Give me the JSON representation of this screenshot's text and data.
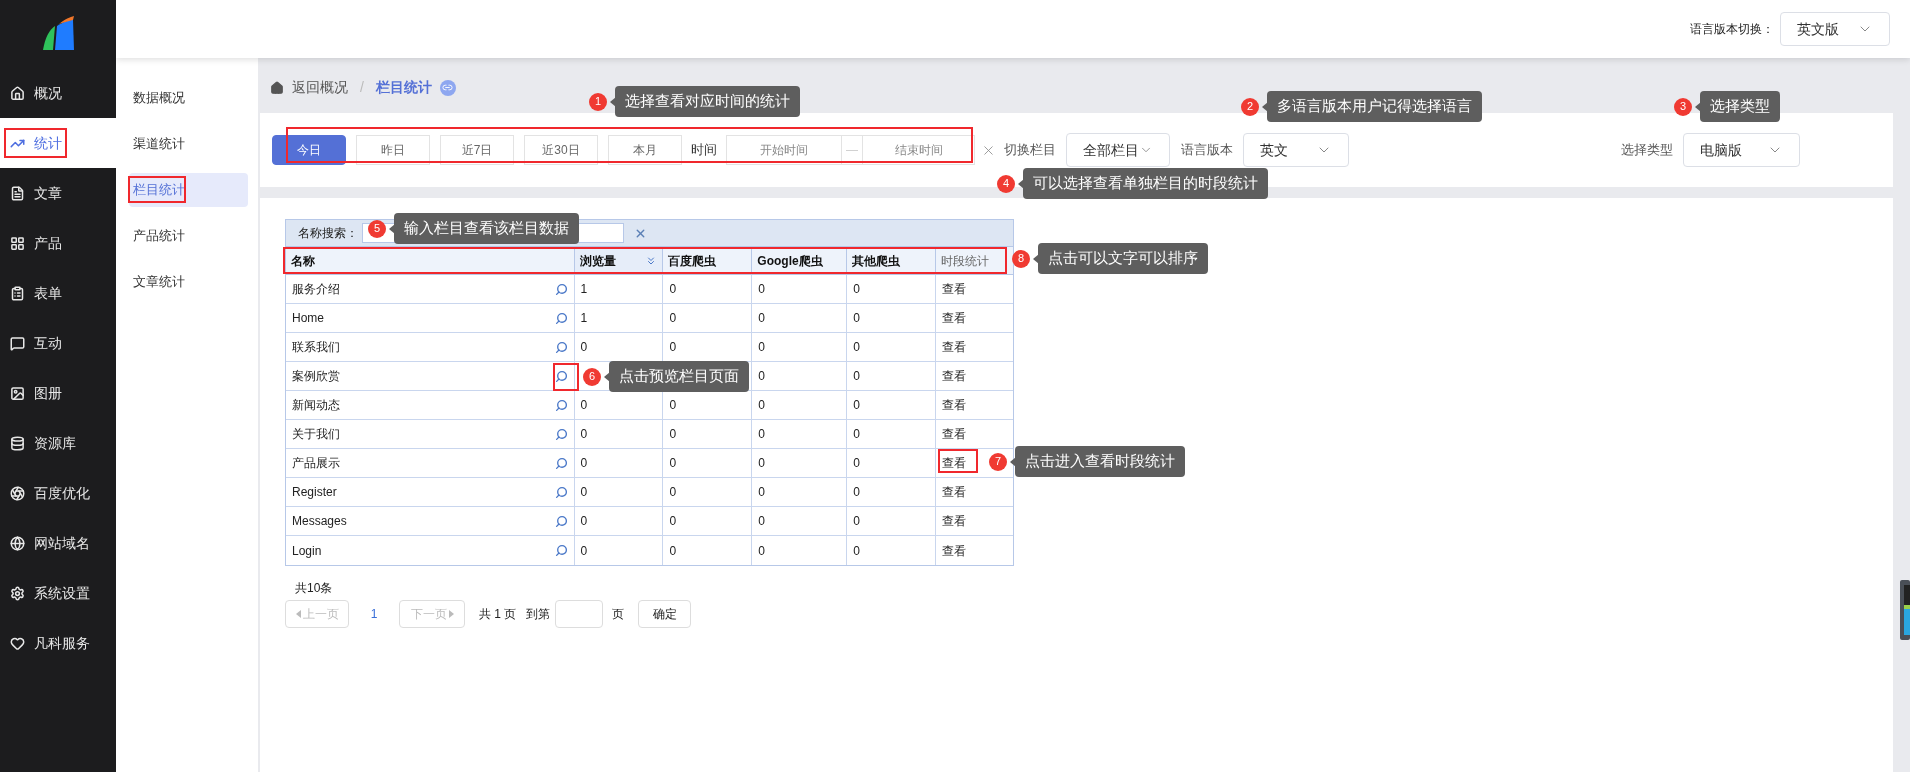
{
  "sidebar": {
    "items": [
      {
        "label": "概况",
        "selected": false
      },
      {
        "label": "统计",
        "selected": true
      },
      {
        "label": "文章",
        "selected": false
      },
      {
        "label": "产品",
        "selected": false
      },
      {
        "label": "表单",
        "selected": false
      },
      {
        "label": "互动",
        "selected": false
      },
      {
        "label": "图册",
        "selected": false
      },
      {
        "label": "资源库",
        "selected": false
      },
      {
        "label": "百度优化",
        "selected": false
      },
      {
        "label": "网站域名",
        "selected": false
      },
      {
        "label": "系统设置",
        "selected": false
      },
      {
        "label": "凡科服务",
        "selected": false
      }
    ]
  },
  "header": {
    "language_label": "语言版本切换：",
    "language_value": "英文版"
  },
  "subnav": {
    "items": [
      {
        "label": "数据概况",
        "selected": false
      },
      {
        "label": "渠道统计",
        "selected": false
      },
      {
        "label": "栏目统计",
        "selected": true
      },
      {
        "label": "产品统计",
        "selected": false
      },
      {
        "label": "文章统计",
        "selected": false
      }
    ]
  },
  "breadcrumb": {
    "back": "返回概况",
    "separator": "/",
    "current": "栏目统计"
  },
  "filters": {
    "periods": [
      {
        "label": "今日",
        "selected": true
      },
      {
        "label": "昨日",
        "selected": false
      },
      {
        "label": "近7日",
        "selected": false
      },
      {
        "label": "近30日",
        "selected": false
      },
      {
        "label": "本月",
        "selected": false
      }
    ],
    "time_label": "时间",
    "start_placeholder": "开始时间",
    "range_separator": "—",
    "end_placeholder": "结束时间",
    "column_label": "切换栏目",
    "column_value": "全部栏目",
    "language_label": "语言版本",
    "language_value": "英文",
    "type_label": "选择类型",
    "type_value": "电脑版"
  },
  "table": {
    "search_label": "名称搜索：",
    "columns": [
      {
        "label": "名称",
        "sortable": true,
        "sorted": false
      },
      {
        "label": "浏览量",
        "sortable": true,
        "sorted": true
      },
      {
        "label": "百度爬虫",
        "sortable": true,
        "sorted": false
      },
      {
        "label": "Google爬虫",
        "sortable": true,
        "sorted": false
      },
      {
        "label": "其他爬虫",
        "sortable": true,
        "sorted": false
      },
      {
        "label": "时段统计",
        "sortable": false,
        "sorted": false
      }
    ],
    "rows": [
      [
        "服务介绍",
        "1",
        "0",
        "0",
        "0",
        "查看"
      ],
      [
        "Home",
        "1",
        "0",
        "0",
        "0",
        "查看"
      ],
      [
        "联系我们",
        "0",
        "0",
        "0",
        "0",
        "查看"
      ],
      [
        "案例欣赏",
        null,
        null,
        "0",
        "0",
        "查看"
      ],
      [
        "新闻动态",
        "0",
        "0",
        "0",
        "0",
        "查看"
      ],
      [
        "关于我们",
        "0",
        "0",
        "0",
        "0",
        "查看"
      ],
      [
        "产品展示",
        "0",
        "0",
        "0",
        "0",
        "查看"
      ],
      [
        "Register",
        "0",
        "0",
        "0",
        "0",
        "查看"
      ],
      [
        "Messages",
        "0",
        "0",
        "0",
        "0",
        "查看"
      ],
      [
        "Login",
        "0",
        "0",
        "0",
        "0",
        "查看"
      ]
    ]
  },
  "pagination": {
    "total": "共10条",
    "prev": "上一页",
    "prev_disabled": true,
    "current": "1",
    "next": "下一页",
    "next_disabled": true,
    "pages": "共 1 页",
    "goto": "到第",
    "page_unit": "页",
    "confirm": "确定"
  },
  "annotations": [
    {
      "number": "1",
      "text": "选择查看对应时间的统计"
    },
    {
      "number": "2",
      "text": "多语言版本用户记得选择语言"
    },
    {
      "number": "3",
      "text": "选择类型"
    },
    {
      "number": "4",
      "text": "可以选择查看单独栏目的时段统计"
    },
    {
      "number": "5",
      "text": "输入栏目查看该栏目数据"
    },
    {
      "number": "8",
      "text": "点击可以文字可以排序"
    },
    {
      "number": "6",
      "text": "点击预览栏目页面"
    },
    {
      "number": "7",
      "text": "点击进入查看时段统计"
    }
  ]
}
